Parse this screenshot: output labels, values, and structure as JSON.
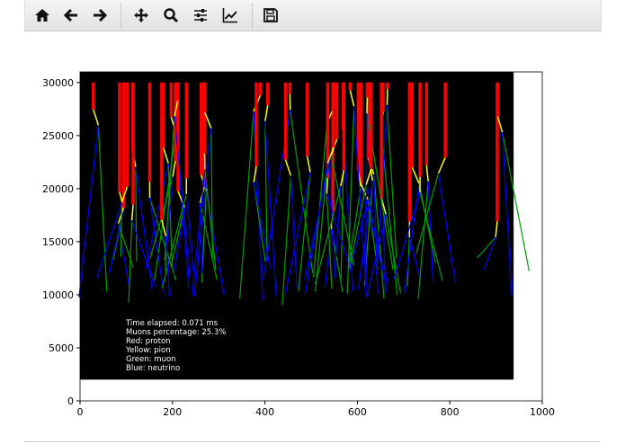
{
  "toolbar": {
    "buttons": [
      {
        "name": "home",
        "icon": "home-icon"
      },
      {
        "name": "back",
        "icon": "arrow-left-icon"
      },
      {
        "name": "forward",
        "icon": "arrow-right-icon"
      },
      {
        "name": "pan",
        "icon": "move-icon"
      },
      {
        "name": "zoom",
        "icon": "magnifier-icon"
      },
      {
        "name": "configure-subplots",
        "icon": "sliders-icon"
      },
      {
        "name": "edit-axis",
        "icon": "line-chart-icon"
      },
      {
        "name": "save",
        "icon": "floppy-disk-icon"
      }
    ]
  },
  "chart_data": {
    "type": "line",
    "title": "",
    "xlabel": "",
    "ylabel": "",
    "xlim": [
      0,
      1000
    ],
    "ylim": [
      0,
      31000
    ],
    "xticks": [
      "0",
      "200",
      "400",
      "600",
      "800",
      "1000"
    ],
    "yticks": [
      "0",
      "5000",
      "10000",
      "15000",
      "20000",
      "25000",
      "30000"
    ],
    "background_region": {
      "x": [
        0,
        938
      ],
      "y": [
        2000,
        31000
      ],
      "color": "#000000"
    },
    "colors": {
      "proton": "#ff0000",
      "pion": "#ffff00",
      "muon": "#00a000",
      "neutrino": "#0000ff"
    },
    "annotation": {
      "time": "Time elapsed: 0.071 ms",
      "muons": "Muons percentage: 25.3%",
      "red": "Red: proton",
      "yellow": "Yellow: pion",
      "green": "Green: muon",
      "blue": "Blue: neutrino"
    }
  }
}
